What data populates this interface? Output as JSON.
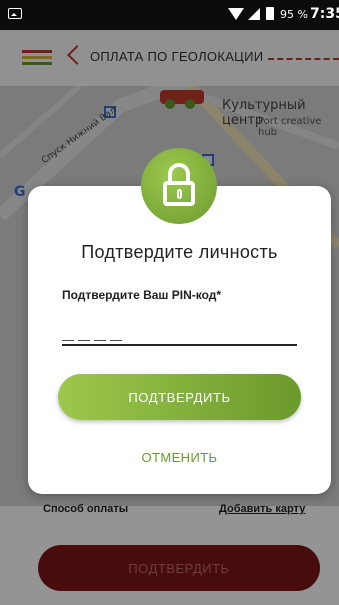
{
  "status_bar": {
    "battery_percent": "95 %",
    "time": "7:35",
    "icons": [
      "screenshot-icon",
      "wifi-icon",
      "signal-icon",
      "battery-icon"
    ]
  },
  "header": {
    "title": "ОПЛАТА ПО ГЕОЛОКАЦИИ",
    "menu_colors": [
      "#c0392b",
      "#e2b33a",
      "#6a9a2b"
    ],
    "accent": "#c0392b"
  },
  "map": {
    "poi_title": "Культурный центр",
    "poi_subtitle": "Port creative hub",
    "street": "Спуск Нижний Вал",
    "logo_letter": "G"
  },
  "payment": {
    "method_label": "Способ оплаты",
    "add_card_label": "Добавить карту",
    "confirm_label": "ПОДТВЕРДИТЬ"
  },
  "modal": {
    "title": "Подтвердите личность",
    "pin_label": "Подтвердите Ваш PIN-код*",
    "pin_placeholder": "____",
    "confirm_label": "ПОДТВЕРДИТЬ",
    "cancel_label": "ОТМЕНИТЬ",
    "accent": "#6a9a2b",
    "accent_light": "#9dc84e"
  }
}
